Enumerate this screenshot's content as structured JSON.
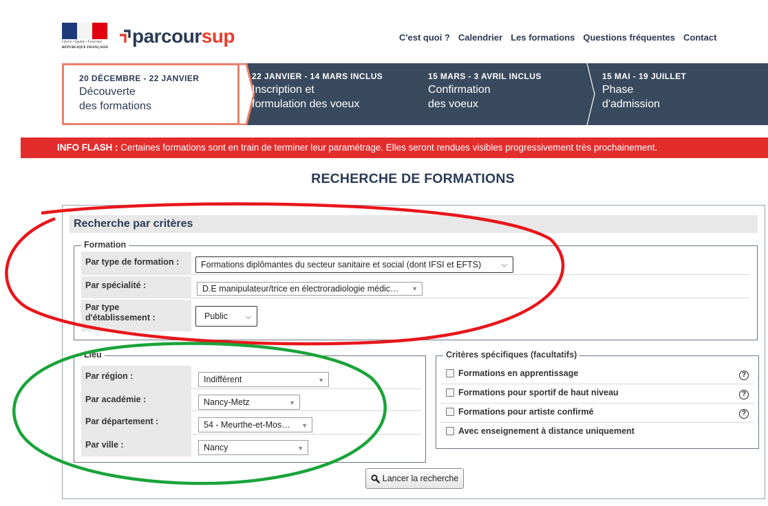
{
  "header": {
    "rf_motto": "Liberté • Égalité • Fraternité",
    "rf_name": "RÉPUBLIQUE FRANÇAISE",
    "logo_text_a": "parcour",
    "logo_text_b": "sup",
    "nav": [
      "C'est quoi ?",
      "Calendrier",
      "Les formations",
      "Questions fréquentes",
      "Contact"
    ]
  },
  "timeline": [
    {
      "date": "20 DÉCEMBRE - 22 JANVIER",
      "line1": "Découverte",
      "line2": "des formations"
    },
    {
      "date": "22 JANVIER - 14 MARS INCLUS",
      "line1": "Inscription et",
      "line2": "formulation des voeux"
    },
    {
      "date": "15 MARS - 3 AVRIL INCLUS",
      "line1": "Confirmation",
      "line2": "des voeux"
    },
    {
      "date": "15 MAI - 19 JUILLET",
      "line1": "Phase",
      "line2": "d'admission"
    }
  ],
  "flash": {
    "label": "INFO FLASH :",
    "text": " Certaines formations sont en train de terminer leur paramétrage. Elles seront rendues visibles progressivement très prochainement."
  },
  "page_title": "RECHERCHE DE FORMATIONS",
  "search": {
    "header": "Recherche par critères",
    "formation": {
      "legend": "Formation",
      "type_label": "Par type de formation :",
      "type_value": "Formations diplômantes du secteur sanitaire et social (dont IFSI et EFTS)",
      "specialite_label": "Par spécialité :",
      "specialite_value": "D.E manipulateur/trice en électroradiologie médic…",
      "etab_label_1": "Par type",
      "etab_label_2": "d'établissement :",
      "etab_value": "Public"
    },
    "lieu": {
      "legend": "Lieu",
      "region_label": "Par région :",
      "region_value": "Indifférent",
      "academie_label": "Par académie :",
      "academie_value": "Nancy-Metz",
      "departement_label": "Par département :",
      "departement_value": "54 - Meurthe-et-Mos…",
      "ville_label": "Par ville :",
      "ville_value": "Nancy"
    },
    "criteres": {
      "legend": "Critères spécifiques (facultatifs)",
      "items": [
        "Formations en apprentissage",
        "Formations pour sportif de haut niveau",
        "Formations pour artiste confirmé",
        "Avec enseignement à distance uniquement"
      ],
      "help_glyph": "?"
    },
    "launch_label": "Lancer la recherche"
  },
  "colors": {
    "navy": "#2b3a55",
    "timeline_bg": "#3a4a5e",
    "flash_red": "#e32d2d",
    "accent_orange": "#e8806a",
    "annotation_red": "#e8161b",
    "annotation_green": "#1aa33a"
  }
}
